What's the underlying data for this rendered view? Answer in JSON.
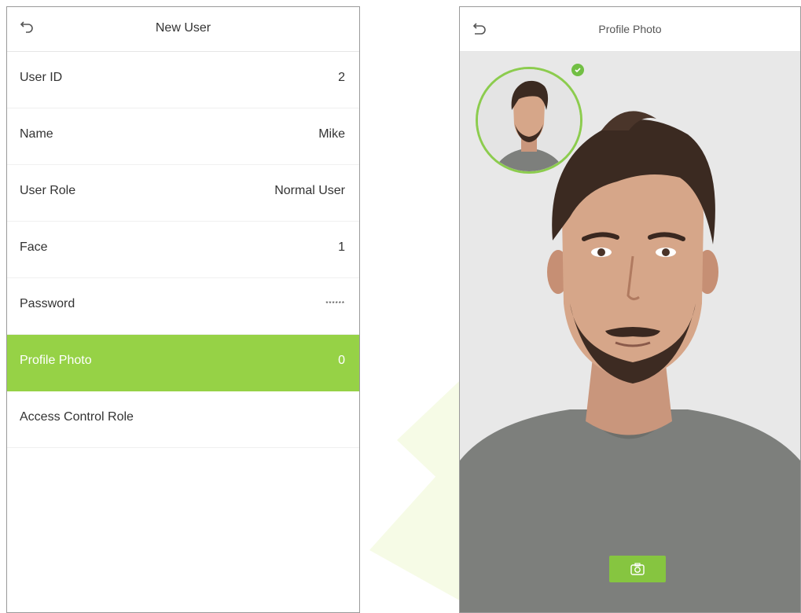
{
  "left_screen": {
    "title": "New User",
    "rows": [
      {
        "label": "User ID",
        "value": "2"
      },
      {
        "label": "Name",
        "value": "Mike"
      },
      {
        "label": "User Role",
        "value": "Normal User"
      },
      {
        "label": "Face",
        "value": "1"
      },
      {
        "label": "Password",
        "value": "******"
      },
      {
        "label": "Profile Photo",
        "value": "0"
      },
      {
        "label": "Access Control Role",
        "value": ""
      }
    ],
    "active_row": "Profile Photo"
  },
  "right_screen": {
    "title": "Profile Photo",
    "capture_icon": "camera-icon",
    "status_icon": "check-icon"
  },
  "colors": {
    "accent_green": "#96d246",
    "capture_green": "#86c540",
    "border_gray": "#9a9a9a"
  }
}
